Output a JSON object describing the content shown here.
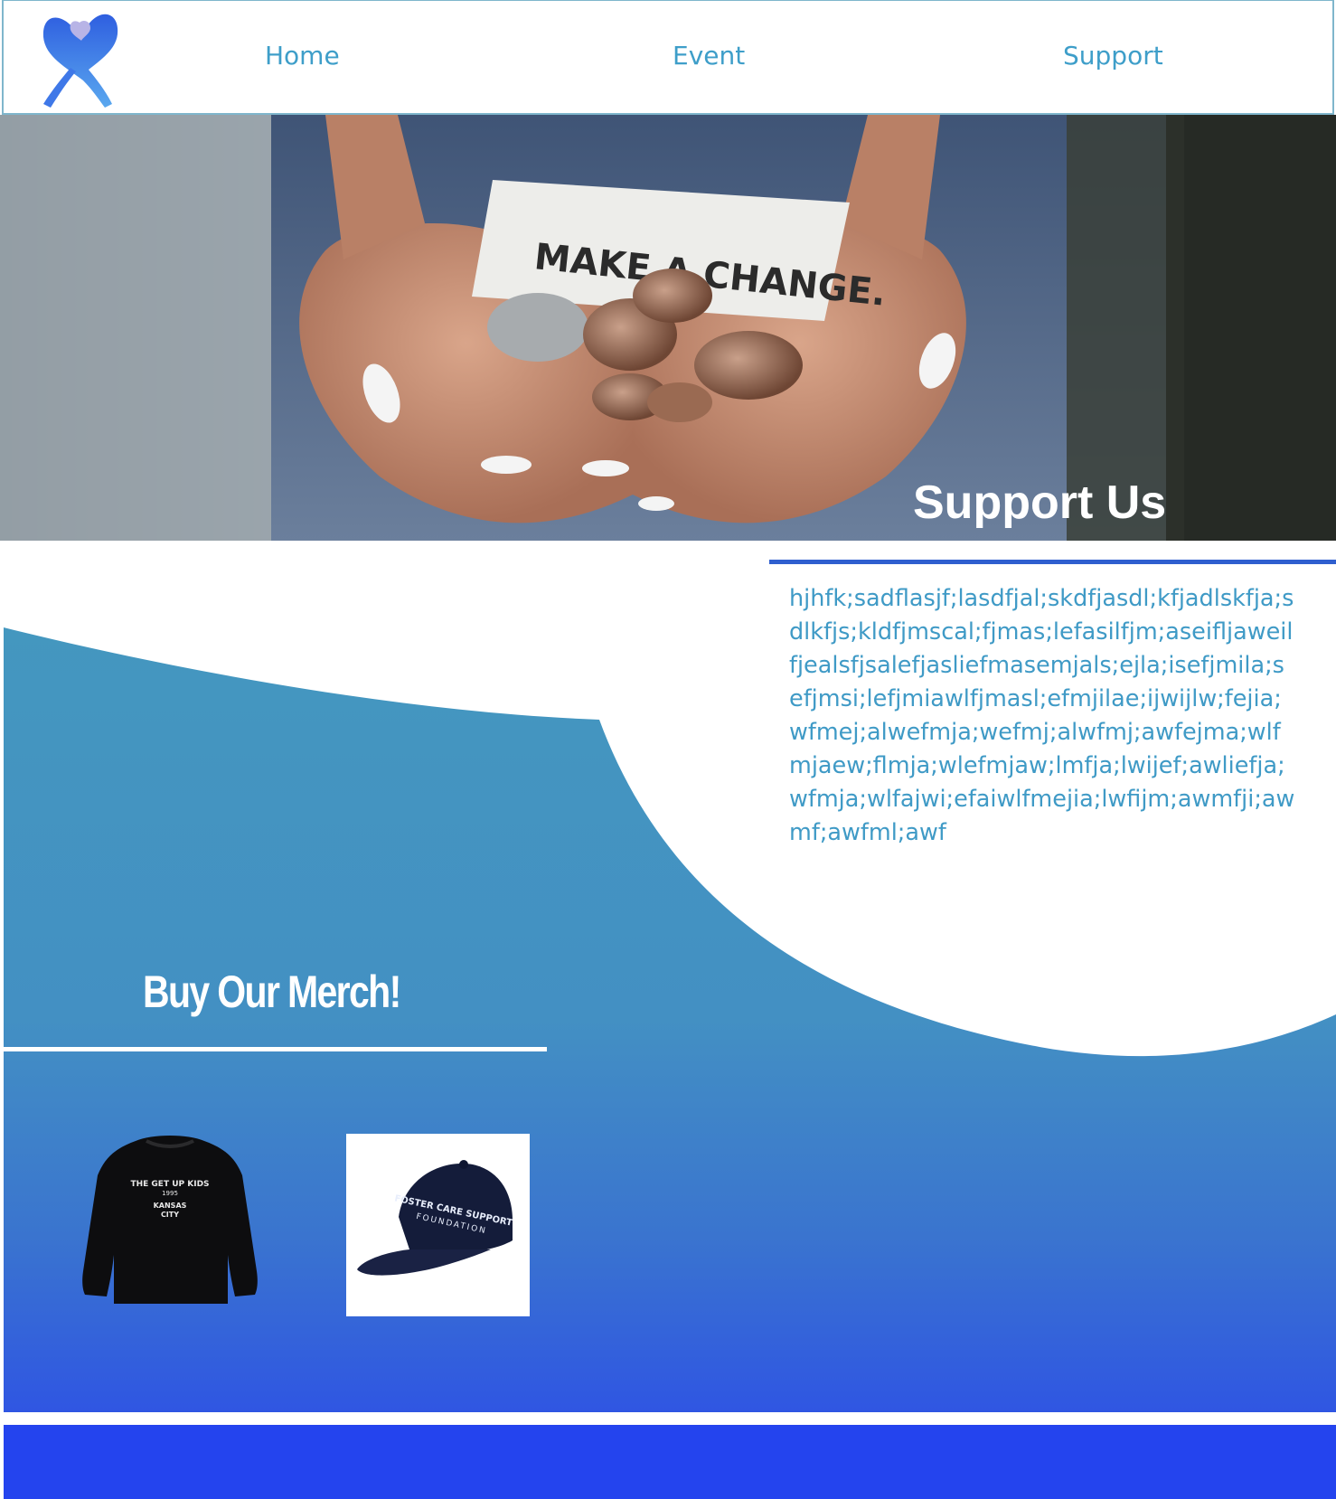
{
  "header": {
    "logo": "awareness-ribbon-heart-logo",
    "nav": [
      {
        "label": "Home"
      },
      {
        "label": "Event"
      },
      {
        "label": "Support"
      }
    ]
  },
  "hero": {
    "image": "hands-holding-coins-photo",
    "note_text": "MAKE A CHANGE.",
    "title": "Support Us"
  },
  "support": {
    "body": "hjhfk;sadflasjf;lasdfjal;skdfjasdl;kfjadlskfja;sdlkfjs;kldfjmscal;fjmas;lefasilfjm;aseifljaweilfjealsfjsalefjasliefmasemjals;ejla;isefjmila;sefjmsi;lefjmiawlfjmasl;efmjilae;ijwijlw;fejia;wfmej;alwefmja;wefmj;alwfmj;awfejma;wlfmjaew;flmja;wlefmjaw;lmfja;lwijef;awliefja;wfmja;wlfajwi;efaiwlfmejia;lwfijm;awmfji;awmf;awfml;awf"
  },
  "merch": {
    "title": "Buy Our Merch!",
    "products": [
      {
        "name": "sweatshirt",
        "print_line1": "THE GET UP KIDS",
        "print_line2": "1995",
        "print_line3": "KANSAS",
        "print_line4": "CITY"
      },
      {
        "name": "cap",
        "print_line1": "FOSTER CARE SUPPORT",
        "print_line2": "FOUNDATION"
      }
    ]
  },
  "colors": {
    "accent": "#3e9ec9",
    "wave_top": "#4497bf",
    "wave_bottom": "#2b4fe6",
    "footer": "#2444ee",
    "rule": "#2f5fcf"
  }
}
